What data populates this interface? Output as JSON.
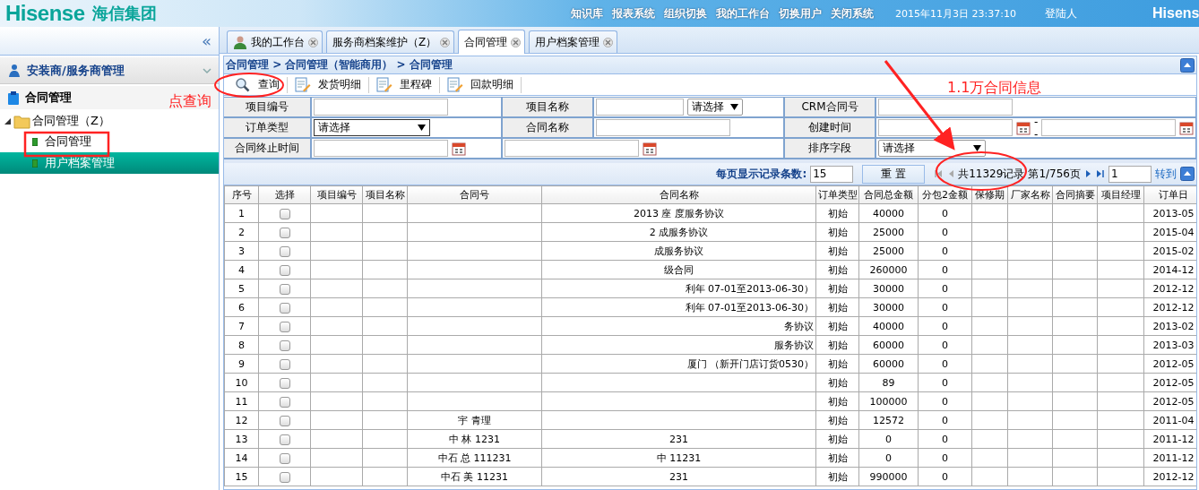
{
  "header": {
    "brand": "Hisense",
    "brand_cn": "海信集团",
    "nav": [
      "知识库",
      "报表系统",
      "组织切换",
      "我的工作台",
      "切换用户",
      "关闭系统"
    ],
    "datetime": "2015年11月3日 23:37:10",
    "user_label": "登陆人",
    "brand_right": "Hisens"
  },
  "sidebar": {
    "collapse": "«",
    "accordion": [
      {
        "label": "安装商/服务商管理",
        "expanded": false
      }
    ],
    "section": "合同管理",
    "tree": [
      {
        "label": "合同管理（Z）",
        "expanded": true,
        "children": [
          {
            "label": "合同管理",
            "selected": false
          },
          {
            "label": "用户档案管理",
            "selected": true
          }
        ]
      }
    ]
  },
  "tabs": [
    {
      "label": "我的工作台",
      "kind": "home",
      "selected": false
    },
    {
      "label": "服务商档案维护（Z）",
      "kind": "page",
      "selected": false
    },
    {
      "label": "合同管理",
      "kind": "page",
      "selected": true
    },
    {
      "label": "用户档案管理",
      "kind": "page",
      "selected": false
    }
  ],
  "breadcrumb": "合同管理 > 合同管理（智能商用） > 合同管理",
  "toolbar": [
    {
      "label": "查询",
      "kind": "search"
    },
    {
      "label": "发货明细",
      "kind": "edit"
    },
    {
      "label": "里程碑",
      "kind": "edit"
    },
    {
      "label": "回款明细",
      "kind": "edit"
    }
  ],
  "form": [
    [
      {
        "kind": "label",
        "text": "项目编号"
      },
      {
        "kind": "input"
      },
      {
        "kind": "label",
        "text": "项目名称"
      },
      {
        "kind": "input_select",
        "value": "请选择"
      },
      {
        "kind": "label",
        "text": "CRM合同号"
      },
      {
        "kind": "input"
      }
    ],
    [
      {
        "kind": "label",
        "text": "订单类型"
      },
      {
        "kind": "select",
        "value": "请选择"
      },
      {
        "kind": "label",
        "text": "合同名称"
      },
      {
        "kind": "input"
      },
      {
        "kind": "label",
        "text": "创建时间"
      },
      {
        "kind": "date_range",
        "separator": "--"
      }
    ],
    [
      {
        "kind": "label",
        "text": "合同终止时间"
      },
      {
        "kind": "date"
      },
      {
        "kind": "date_wide"
      },
      {
        "kind": "label",
        "text": "排序字段"
      },
      {
        "kind": "select",
        "value": "请选择"
      }
    ]
  ],
  "pager": {
    "size_label": "每页显示记录条数:",
    "size": "15",
    "reset": "重 置",
    "total": "共11329记录",
    "page": "第1/756页",
    "goto_value": "1",
    "goto": "转到"
  },
  "table": {
    "columns": [
      "序号",
      "选择",
      "项目编号",
      "项目名称",
      "合同号",
      "合同名称",
      "订单类型",
      "合同总金额",
      "分包2金额",
      "保修期",
      "厂家名称",
      "合同摘要",
      "项目经理",
      "订单日"
    ],
    "rows": [
      {
        "checked": false,
        "cells": [
          "1",
          "",
          "",
          "",
          "",
          "2013 座 度服务协议",
          "初始",
          "40000",
          "0",
          "",
          "",
          "",
          "",
          "2013-05"
        ]
      },
      {
        "checked": false,
        "cells": [
          "2",
          "",
          "",
          "",
          "",
          "2 成服务协议",
          "初始",
          "25000",
          "0",
          "",
          "",
          "",
          "",
          "2015-04"
        ]
      },
      {
        "checked": false,
        "cells": [
          "3",
          "",
          "",
          "",
          "",
          "成服务协议",
          "初始",
          "25000",
          "0",
          "",
          "",
          "",
          "",
          "2015-02"
        ]
      },
      {
        "checked": false,
        "cells": [
          "4",
          "",
          "",
          "",
          "",
          "级合同",
          "初始",
          "260000",
          "0",
          "",
          "",
          "",
          "",
          "2014-12"
        ]
      },
      {
        "checked": false,
        "cells": [
          "5",
          "",
          "",
          "",
          "",
          "利年 07-01至2013-06-30）",
          "初始",
          "30000",
          "0",
          "",
          "",
          "",
          "",
          "2012-12"
        ]
      },
      {
        "checked": false,
        "cells": [
          "6",
          "",
          "",
          "",
          "",
          "利年 07-01至2013-06-30）",
          "初始",
          "30000",
          "0",
          "",
          "",
          "",
          "",
          "2012-12"
        ]
      },
      {
        "checked": false,
        "cells": [
          "7",
          "",
          "",
          "",
          "",
          "务协议",
          "初始",
          "40000",
          "0",
          "",
          "",
          "",
          "",
          "2013-02"
        ]
      },
      {
        "checked": false,
        "cells": [
          "8",
          "",
          "",
          "",
          "",
          "服务协议",
          "初始",
          "60000",
          "0",
          "",
          "",
          "",
          "",
          "2013-03"
        ]
      },
      {
        "checked": false,
        "cells": [
          "9",
          "",
          "",
          "",
          "",
          "厦门 （新开门店订货0530）",
          "初始",
          "60000",
          "0",
          "",
          "",
          "",
          "",
          "2012-05"
        ]
      },
      {
        "checked": false,
        "cells": [
          "10",
          "",
          "",
          "",
          "",
          "",
          "初始",
          "89",
          "0",
          "",
          "",
          "",
          "",
          "2012-05"
        ]
      },
      {
        "checked": false,
        "cells": [
          "11",
          "",
          "",
          "",
          "",
          "",
          "初始",
          "100000",
          "0",
          "",
          "",
          "",
          "",
          "2012-05"
        ]
      },
      {
        "checked": false,
        "cells": [
          "12",
          "",
          "",
          "",
          "宇 青理",
          "",
          "初始",
          "12572",
          "0",
          "",
          "",
          "",
          "",
          "2011-04"
        ]
      },
      {
        "checked": false,
        "cells": [
          "13",
          "",
          "",
          "",
          "中 林 1231",
          "231",
          "初始",
          "0",
          "0",
          "",
          "",
          "",
          "",
          "2011-12"
        ]
      },
      {
        "checked": false,
        "cells": [
          "14",
          "",
          "",
          "",
          "中石 总 111231",
          "中 11231",
          "初始",
          "0",
          "0",
          "",
          "",
          "",
          "",
          "2011-12"
        ]
      },
      {
        "checked": false,
        "cells": [
          "15",
          "",
          "",
          "",
          "中石 美 11231",
          "231",
          "初始",
          "990000",
          "0",
          "",
          "",
          "",
          "",
          "2012-12"
        ]
      }
    ]
  },
  "annotations": [
    {
      "kind": "hint_left",
      "text": "点查询"
    },
    {
      "kind": "hint_right",
      "text": "1.1万合同信息"
    }
  ]
}
